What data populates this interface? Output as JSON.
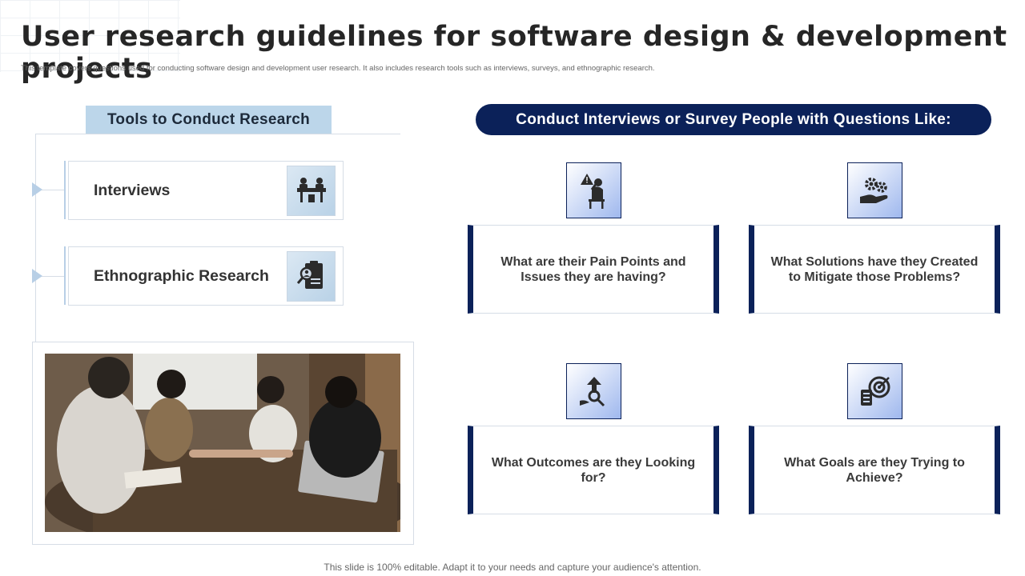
{
  "slide": {
    "title": "User research guidelines for software design & development projects",
    "subtitle": "This template covers questions used for conducting software design and development user research. It also includes research tools such as interviews, surveys, and ethnographic research.",
    "footer": "This slide is 100% editable. Adapt it to your needs and capture your audience's attention."
  },
  "tools": {
    "header": "Tools to Conduct Research",
    "items": [
      {
        "label": "Interviews",
        "icon": "meeting-table-icon"
      },
      {
        "label": "Ethnographic Research",
        "icon": "profile-magnifier-icon"
      }
    ],
    "photo_icon": "team-meeting-photo"
  },
  "questions": {
    "header": "Conduct Interviews or Survey People with Questions Like:",
    "items": [
      {
        "text": "What are their Pain Points and Issues they are having?",
        "icon": "stressed-person-icon"
      },
      {
        "text": "What Solutions have they Created to Mitigate those Problems?",
        "icon": "gears-hand-icon"
      },
      {
        "text": "What Outcomes are they Looking for?",
        "icon": "growth-search-icon"
      },
      {
        "text": "What Goals are they Trying to Achieve?",
        "icon": "target-checklist-icon"
      }
    ]
  },
  "colors": {
    "navy": "#0b2159",
    "light_blue": "#bcd6ea",
    "line": "#d6dde6"
  }
}
